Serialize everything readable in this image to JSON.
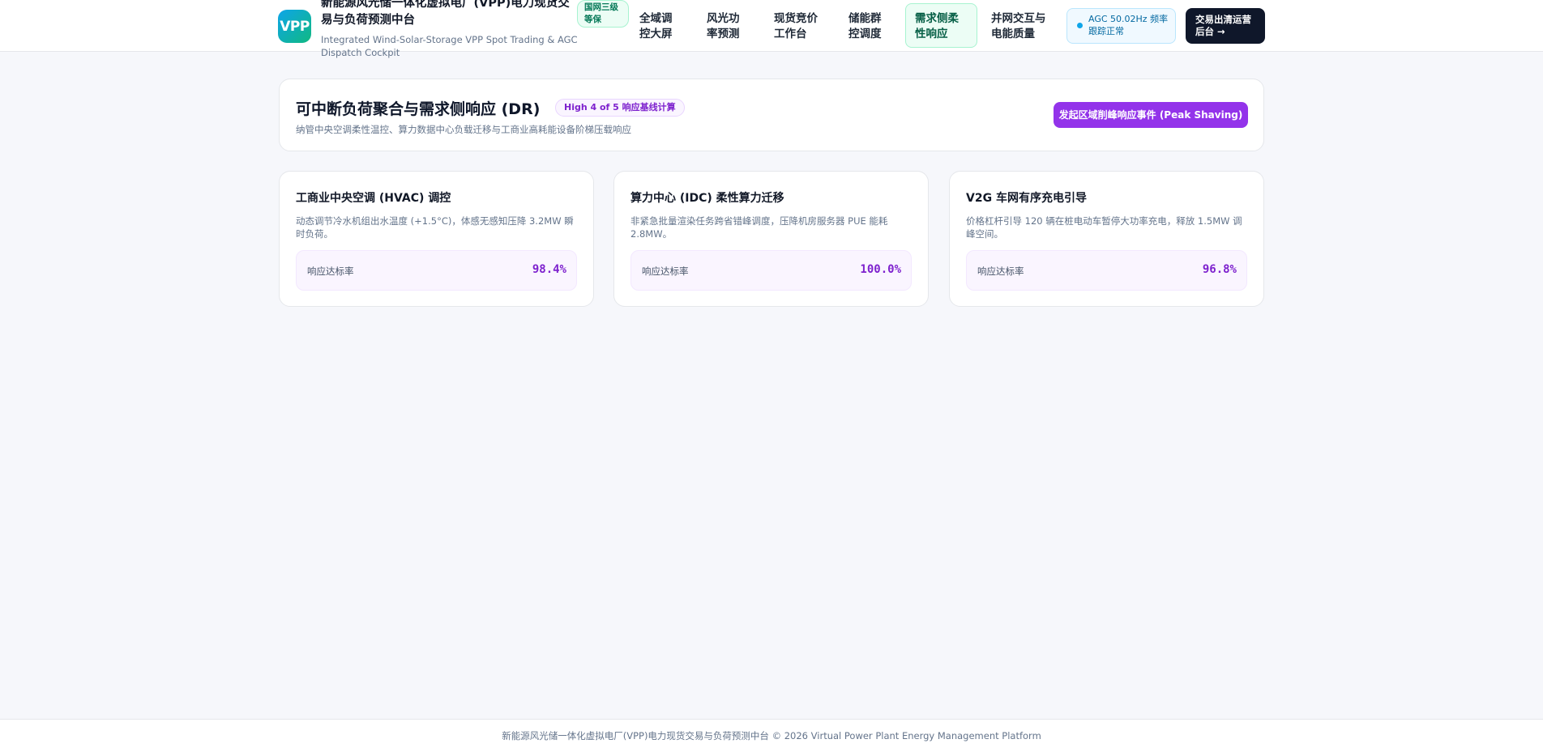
{
  "header": {
    "logo_text": "VPP",
    "title": "新能源风光储一体化虚拟电厂(VPP)电力现货交易与负荷预测中台",
    "subtitle": "Integrated Wind-Solar-Storage VPP Spot Trading & AGC Dispatch Cockpit",
    "cert_badge": "国网三级等保",
    "nav": [
      {
        "label": "全域调控大屏"
      },
      {
        "label": "风光功率预测"
      },
      {
        "label": "现货竞价工作台"
      },
      {
        "label": "储能群控调度"
      },
      {
        "label": "需求侧柔性响应",
        "active": true
      },
      {
        "label": "并网交互与电能质量"
      }
    ],
    "agc_status": "AGC 50.02Hz 频率跟踪正常",
    "ops_button": "交易出清运营后台 →"
  },
  "dr": {
    "title": "可中断负荷聚合与需求侧响应 (DR)",
    "badge": "High 4 of 5 响应基线计算",
    "description": "纳管中央空调柔性温控、算力数据中心负载迁移与工商业高耗能设备阶梯压载响应",
    "action_button": "发起区域削峰响应事件 (Peak Shaving)"
  },
  "cards": [
    {
      "title": "工商业中央空调 (HVAC) 调控",
      "description": "动态调节冷水机组出水温度 (+1.5°C)，体感无感知压降 3.2MW 瞬时负荷。",
      "metric_label": "响应达标率",
      "metric_value": "98.4%"
    },
    {
      "title": "算力中心 (IDC) 柔性算力迁移",
      "description": "非紧急批量渲染任务跨省错峰调度，压降机房服务器 PUE 能耗 2.8MW。",
      "metric_label": "响应达标率",
      "metric_value": "100.0%"
    },
    {
      "title": "V2G 车网有序充电引导",
      "description": "价格杠杆引导 120 辆在桩电动车暂停大功率充电，释放 1.5MW 调峰空间。",
      "metric_label": "响应达标率",
      "metric_value": "96.8%"
    }
  ],
  "footer": {
    "text": "新能源风光储一体化虚拟电厂(VPP)电力现货交易与负荷预测中台 © 2026 Virtual Power Plant Energy Management Platform"
  },
  "colors": {
    "accent_purple": "#9333ea",
    "nav_active_green": "#ecfdf5",
    "ops_dark": "#0f172a",
    "agc_blue": "#0ea5e9"
  }
}
